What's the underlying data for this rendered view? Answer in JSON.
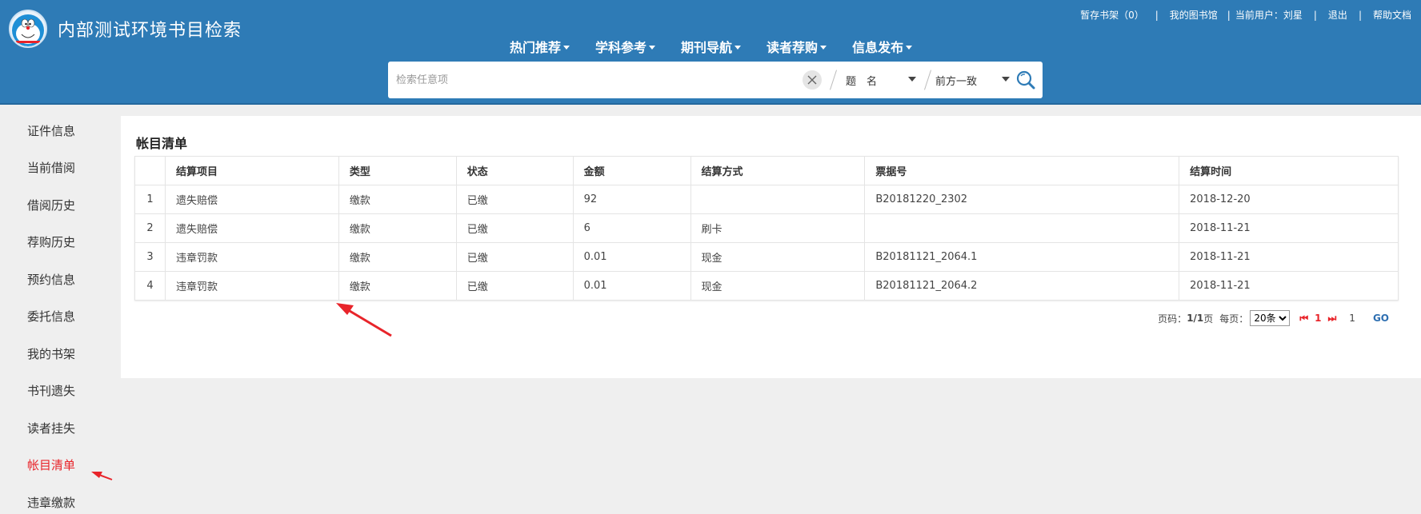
{
  "header": {
    "site_title": "内部测试环境书目检索",
    "top_links": {
      "temp_shelf": "暂存书架（0）",
      "my_library": "我的图书馆",
      "current_user_label": "当前用户：",
      "current_user_name": "刘星",
      "logout": "退出",
      "help": "帮助文档"
    },
    "nav": [
      "热门推荐",
      "学科参考",
      "期刊导航",
      "读者荐购",
      "信息发布"
    ],
    "search": {
      "placeholder": "检索任意项",
      "field": "题　名",
      "match": "前方一致"
    }
  },
  "sidebar": {
    "items": [
      "证件信息",
      "当前借阅",
      "借阅历史",
      "荐购历史",
      "预约信息",
      "委托信息",
      "我的书架",
      "书刊遗失",
      "读者挂失",
      "帐目清单",
      "违章缴款"
    ],
    "active_index": 9
  },
  "main": {
    "title": "帐目清单",
    "table": {
      "columns": [
        "",
        "结算项目",
        "类型",
        "状态",
        "金额",
        "结算方式",
        "票据号",
        "结算时间"
      ],
      "rows": [
        [
          "1",
          "遗失赔偿",
          "缴款",
          "已缴",
          "92",
          "",
          "B20181220_2302",
          "2018-12-20"
        ],
        [
          "2",
          "遗失赔偿",
          "缴款",
          "已缴",
          "6",
          "刷卡",
          "",
          "2018-11-21"
        ],
        [
          "3",
          "违章罚款",
          "缴款",
          "已缴",
          "0.01",
          "现金",
          "B20181121_2064.1",
          "2018-11-21"
        ],
        [
          "4",
          "违章罚款",
          "缴款",
          "已缴",
          "0.01",
          "现金",
          "B20181121_2064.2",
          "2018-11-21"
        ]
      ]
    },
    "pager": {
      "page_label": "页码：",
      "page_value": "1/1",
      "page_unit": "页",
      "per_page_label": "每页：",
      "per_page_value": "20条",
      "first_symbol": "⏮",
      "current_page": "1",
      "last_symbol": "⏭",
      "page_input": "1",
      "go": "GO"
    }
  },
  "colors": {
    "header_blue": "#2e7bb6",
    "active_red": "#e8242a",
    "annotation_red": "#e8242a"
  }
}
